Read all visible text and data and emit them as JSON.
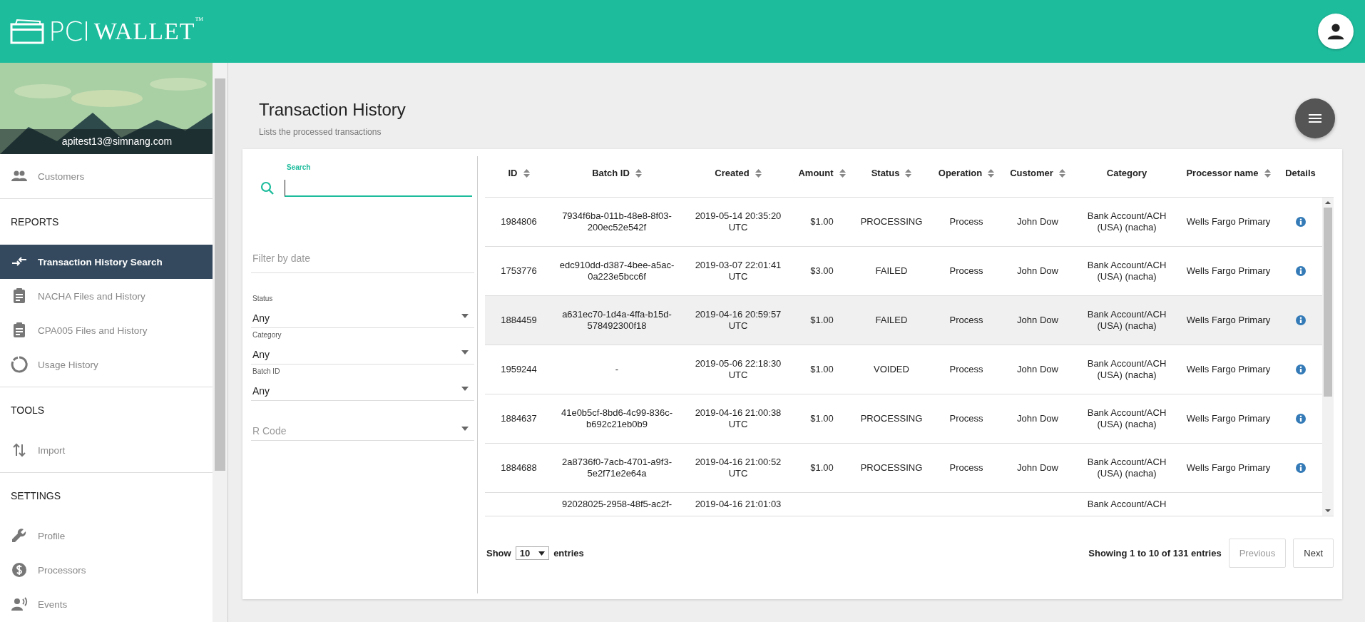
{
  "header": {
    "brand": "PCI",
    "brand_suffix": "WALLET$^{™}$"
  },
  "sidebar": {
    "email": "apitest13@simnang.com",
    "groups": [
      {
        "items": [
          {
            "label": "Customers",
            "selected": false
          }
        ]
      },
      {
        "heading": "REPORTS",
        "items": [
          {
            "label": "Transaction History Search",
            "selected": true
          },
          {
            "label": "NACHA Files and History",
            "selected": false
          },
          {
            "label": "CPA005 Files and History",
            "selected": false
          },
          {
            "label": "Usage History",
            "selected": false
          }
        ]
      },
      {
        "heading": "TOOLS",
        "items": [
          {
            "label": "Import",
            "selected": false
          }
        ]
      },
      {
        "heading": "SETTINGS",
        "items": [
          {
            "label": "Profile",
            "selected": false
          },
          {
            "label": "Processors",
            "selected": false
          },
          {
            "label": "Events",
            "selected": false
          }
        ]
      }
    ]
  },
  "page": {
    "title": "Transaction History",
    "subtitle": "Lists the processed transactions"
  },
  "filters": {
    "search": {
      "label": "Search",
      "focused": true
    },
    "date": {
      "placeholder": "Filter by date"
    },
    "selects": [
      {
        "label": "Status",
        "value": "Any"
      },
      {
        "label": "Category",
        "value": "Any"
      },
      {
        "label": "Batch ID",
        "value": "Any"
      },
      {
        "placeholder": "R Code"
      }
    ]
  },
  "table": {
    "columns": [
      {
        "label": "ID",
        "sortable": true
      },
      {
        "label": "Batch ID",
        "sortable": true
      },
      {
        "label": "Created",
        "sortable": true
      },
      {
        "label": "Amount",
        "sortable": true
      },
      {
        "label": "Status",
        "sortable": true
      },
      {
        "label": "Operation",
        "sortable": true
      },
      {
        "label": "Customer",
        "sortable": true
      },
      {
        "label": "Category",
        "sortable": false
      },
      {
        "label": "Processor name",
        "sortable": true
      },
      {
        "label": "Details",
        "sortable": false
      }
    ],
    "rows": [
      {
        "selected": false,
        "id": "1984806",
        "batch_id": "7934f6ba-011b-48e8-8f03-200ec52e542f",
        "created": "2019-05-14 20:35:20 UTC",
        "amount": "$1.00",
        "status": "PROCESSING",
        "operation": "Process",
        "customer": "John Dow",
        "category": "Bank Account/ACH (USA) (nacha)",
        "processor": "Wells Fargo Primary",
        "details": true
      },
      {
        "selected": false,
        "id": "1753776",
        "batch_id": "edc910dd-d387-4bee-a5ac-0a223e5bcc6f",
        "created": "2019-03-07 22:01:41 UTC",
        "amount": "$3.00",
        "status": "FAILED",
        "operation": "Process",
        "customer": "John Dow",
        "category": "Bank Account/ACH (USA) (nacha)",
        "processor": "Wells Fargo Primary",
        "details": true
      },
      {
        "selected": true,
        "id": "1884459",
        "batch_id": "a631ec70-1d4a-4ffa-b15d-578492300f18",
        "created": "2019-04-16 20:59:57 UTC",
        "amount": "$1.00",
        "status": "FAILED",
        "operation": "Process",
        "customer": "John Dow",
        "category": "Bank Account/ACH (USA) (nacha)",
        "processor": "Wells Fargo Primary",
        "details": true
      },
      {
        "selected": false,
        "id": "1959244",
        "batch_id": "-",
        "created": "2019-05-06 22:18:30 UTC",
        "amount": "$1.00",
        "status": "VOIDED",
        "operation": "Process",
        "customer": "John Dow",
        "category": "Bank Account/ACH (USA) (nacha)",
        "processor": "Wells Fargo Primary",
        "details": true
      },
      {
        "selected": false,
        "id": "1884637",
        "batch_id": "41e0b5cf-8bd6-4c99-836c-b692c21eb0b9",
        "created": "2019-04-16 21:00:38 UTC",
        "amount": "$1.00",
        "status": "PROCESSING",
        "operation": "Process",
        "customer": "John Dow",
        "category": "Bank Account/ACH (USA) (nacha)",
        "processor": "Wells Fargo Primary",
        "details": true
      },
      {
        "selected": false,
        "id": "1884688",
        "batch_id": "2a8736f0-7acb-4701-a9f3-5e2f71e2e64a",
        "created": "2019-04-16 21:00:52 UTC",
        "amount": "$1.00",
        "status": "PROCESSING",
        "operation": "Process",
        "customer": "John Dow",
        "category": "Bank Account/ACH (USA) (nacha)",
        "processor": "Wells Fargo Primary",
        "details": true
      },
      {
        "selected": false,
        "batch_id": "92028025-2958-48f5-ac2f-",
        "created": "2019-04-16 21:01:03",
        "category": "Bank Account/ACH"
      }
    ]
  },
  "pagination": {
    "show": "Show",
    "page_size": "10",
    "entries": "entries",
    "summary": "Showing 1 to 10 of 131 entries",
    "buttons": [
      {
        "label": "Previous",
        "disabled": true
      },
      {
        "label": "Next",
        "disabled": false
      }
    ]
  }
}
